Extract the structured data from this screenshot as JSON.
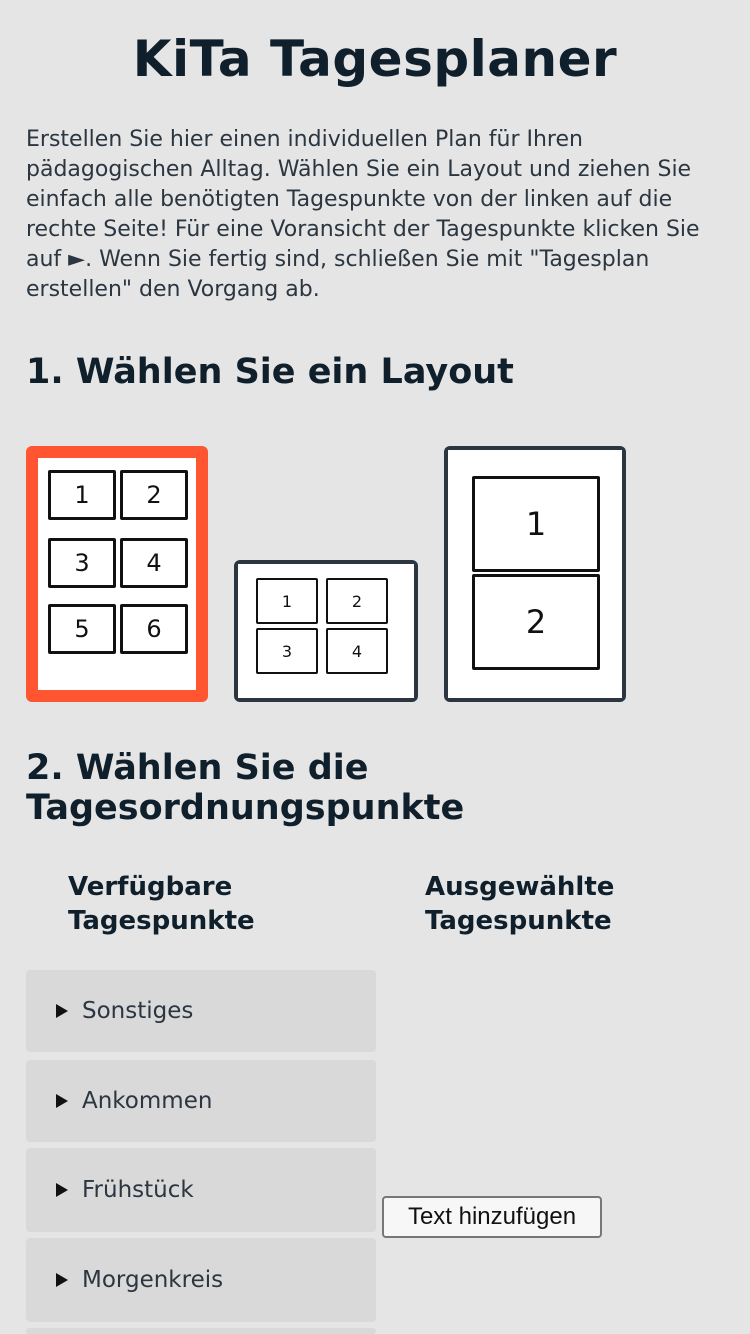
{
  "title": "KiTa Tagesplaner",
  "intro": "Erstellen Sie hier einen individuellen Plan für Ihren pädagogischen Alltag. Wählen Sie ein Layout und ziehen Sie einfach alle benötigten Tagespunkte von der linken auf die rechte Seite! Für eine Voransicht der Tagespunkte klicken Sie auf ►. Wenn Sie fertig sind, schließen Sie mit \"Tagesplan erstellen\" den Vorgang ab.",
  "step1": {
    "heading": "1. Wählen Sie ein Layout"
  },
  "layouts": {
    "six": {
      "cells": [
        "1",
        "2",
        "3",
        "4",
        "5",
        "6"
      ],
      "selected": true,
      "border_color": "#ff5530"
    },
    "four": {
      "cells": [
        "1",
        "2",
        "3",
        "4"
      ],
      "selected": false,
      "border_color": "#2b3641"
    },
    "two": {
      "cells": [
        "1",
        "2"
      ],
      "selected": false,
      "border_color": "#2b3641"
    }
  },
  "step2": {
    "heading": "2. Wählen Sie die Tagesordnungspunkte",
    "available_heading_line1": "Verfügbare",
    "available_heading_line2": "Tagespunkte",
    "selected_heading_line1": "Ausgewählte",
    "selected_heading_line2": "Tagespunkte",
    "categories": [
      {
        "label": "Sonstiges",
        "icon": "triangle-right-icon"
      },
      {
        "label": "Ankommen",
        "icon": "triangle-right-icon"
      },
      {
        "label": "Frühstück",
        "icon": "triangle-right-icon"
      },
      {
        "label": "Morgenkreis",
        "icon": "triangle-right-icon"
      }
    ],
    "add_text_button": "Text hinzufügen"
  }
}
